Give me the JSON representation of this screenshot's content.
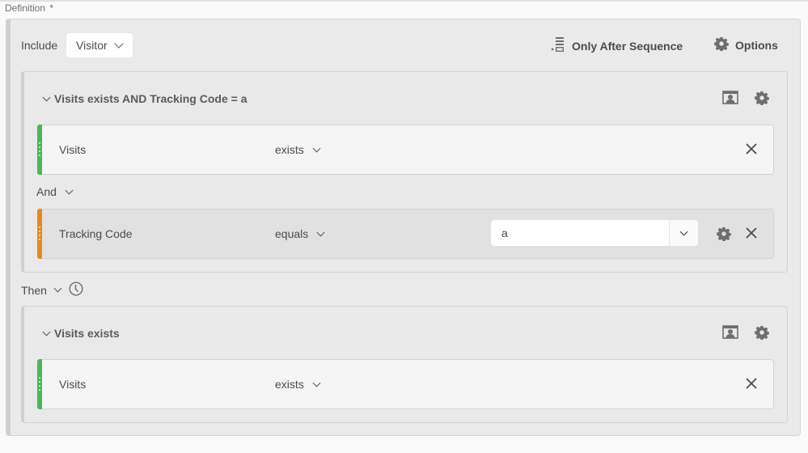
{
  "definition": {
    "label": "Definition",
    "required_marker": "*"
  },
  "toolbar": {
    "include_label": "Include",
    "include_scope": "Visitor",
    "sequence_label": "Only After Sequence",
    "options_label": "Options"
  },
  "containers": [
    {
      "title": "Visits exists AND Tracking Code = a",
      "rules": [
        {
          "name": "Visits",
          "operator": "exists",
          "color": "#4ab75a",
          "value": null
        },
        {
          "name": "Tracking Code",
          "operator": "equals",
          "color": "#e8891c",
          "value": "a"
        }
      ],
      "connector": "And"
    },
    {
      "title": "Visits exists",
      "rules": [
        {
          "name": "Visits",
          "operator": "exists",
          "color": "#4ab75a",
          "value": null
        }
      ]
    }
  ],
  "sequence_connector": "Then",
  "colors": {
    "dimension": "#e8891c",
    "metric": "#4ab75a"
  }
}
